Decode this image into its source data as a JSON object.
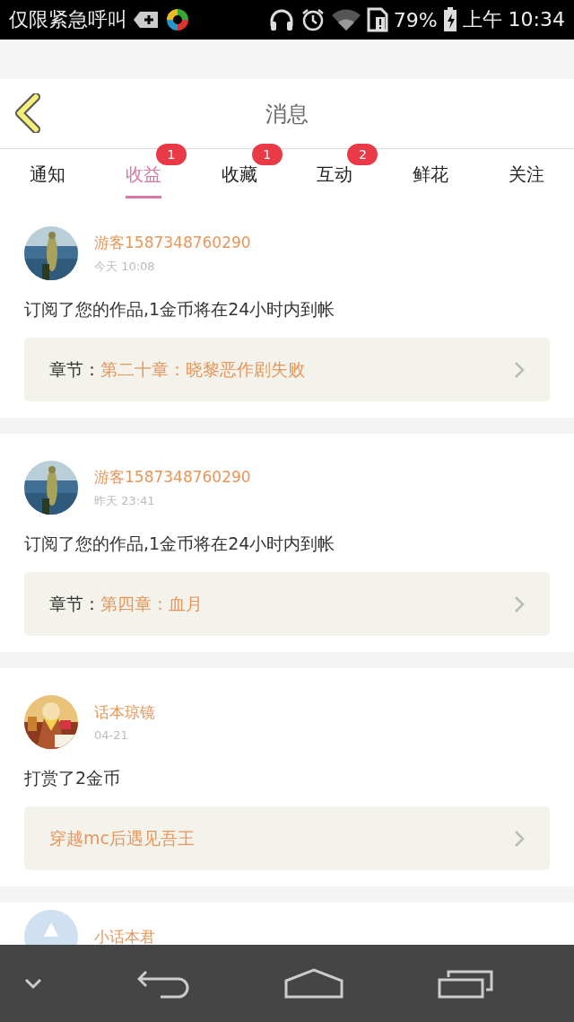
{
  "status_bar": {
    "carrier": "仅限紧急呼叫",
    "battery": "79%",
    "time": "上午 10:34"
  },
  "header": {
    "title": "消息"
  },
  "tabs": [
    {
      "label": "通知",
      "selected": false
    },
    {
      "label": "收益",
      "selected": true,
      "badge": "1"
    },
    {
      "label": "收藏",
      "selected": false,
      "badge": "1"
    },
    {
      "label": "互动",
      "selected": false,
      "badge": "2"
    },
    {
      "label": "鲜花",
      "selected": false
    },
    {
      "label": "关注",
      "selected": false
    }
  ],
  "messages": [
    {
      "name": "游客1587348760290",
      "time": "今天 10:08",
      "text": "订阅了您的作品,1金币将在24小时内到帐",
      "link_label": "章节：",
      "link_title": "第二十章：晓黎恶作剧失败"
    },
    {
      "name": "游客1587348760290",
      "time": "昨天 23:41",
      "text": "订阅了您的作品,1金币将在24小时内到帐",
      "link_label": "章节：",
      "link_title": "第四章：血月"
    },
    {
      "name": "话本琼镜",
      "time": "04-21",
      "text": "打赏了2金币",
      "link_title": "穿越mc后遇见吾王"
    },
    {
      "name": "小话本君"
    }
  ]
}
